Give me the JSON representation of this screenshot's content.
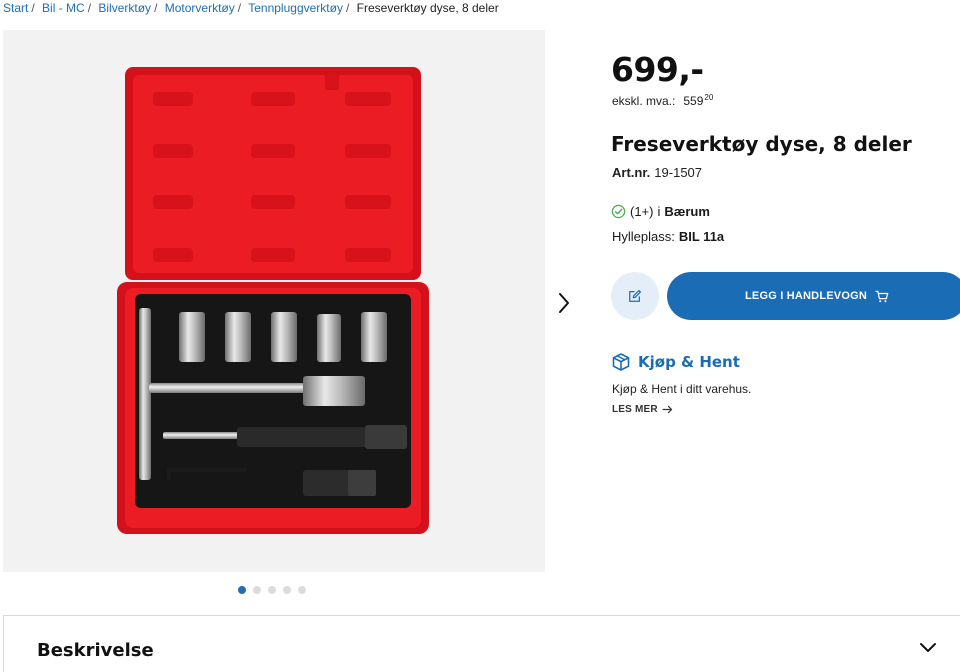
{
  "breadcrumb": {
    "items": [
      "Start",
      "Bil - MC",
      "Bilverktøy",
      "Motorverktøy",
      "Tennpluggverktøy"
    ],
    "separator": "/",
    "current": "Freseverktøy dyse, 8 deler"
  },
  "gallery": {
    "image_subject": "red-case-tool-set-image",
    "dots_total": 5,
    "active_index": 0
  },
  "product": {
    "price": "699,-",
    "ex_vat_label": "ekskl. mva.:",
    "ex_vat_main": "559",
    "ex_vat_cents": "20",
    "title": "Freseverktøy dyse, 8 deler",
    "art_label": "Art.nr.",
    "art_number": "19-1507"
  },
  "stock": {
    "count": "(1+)",
    "in": "i",
    "store": "Bærum",
    "shelf_label": "Hylleplass:",
    "shelf_value": "BIL 11a"
  },
  "actions": {
    "add_to_cart": "LEGG I HANDLEVOGN",
    "note_icon": "edit-icon",
    "cart_icon": "cart-icon"
  },
  "click_collect": {
    "title": "Kjøp & Hent",
    "text": "Kjøp & Hent i ditt varehus.",
    "more": "LES MER"
  },
  "description": {
    "title": "Beskrivelse"
  },
  "colors": {
    "accent": "#1a6cb4",
    "link": "#1f6fb2",
    "success": "#4caf50",
    "case_red": "#e8141b"
  }
}
